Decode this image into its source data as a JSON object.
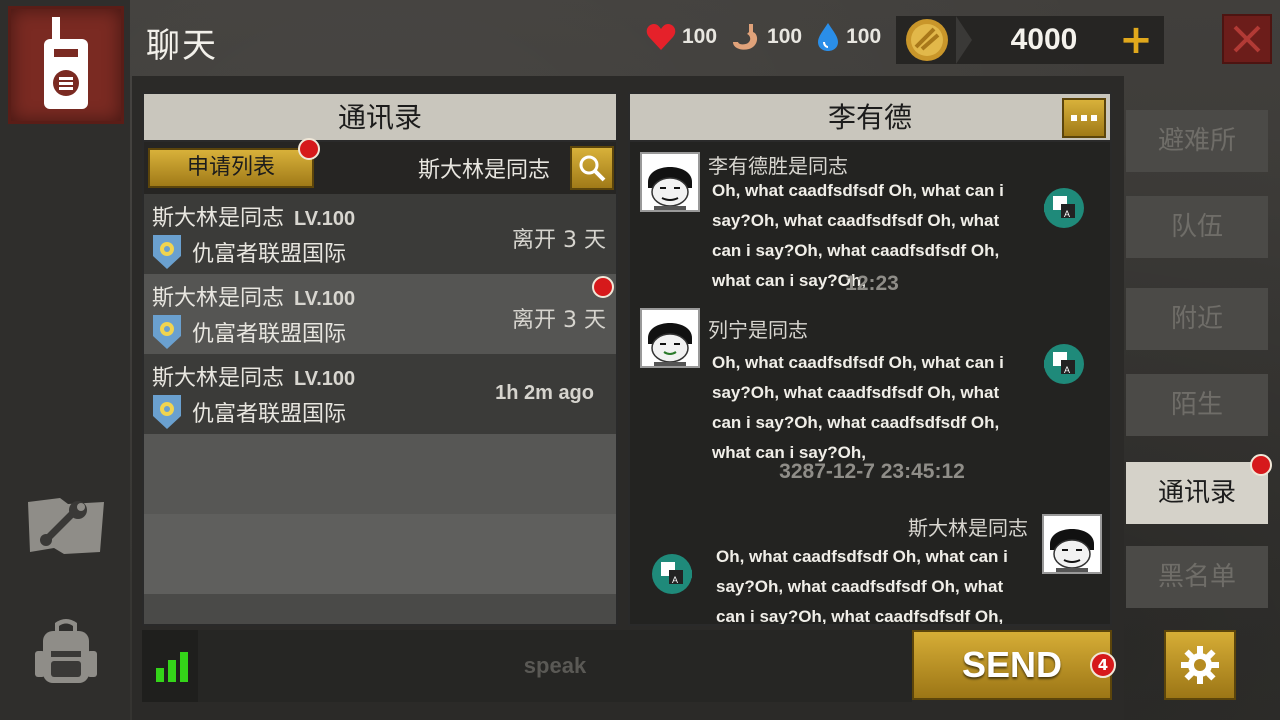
{
  "header": {
    "title": "聊天",
    "stats": [
      {
        "icon": "heart-icon",
        "value": "100"
      },
      {
        "icon": "stomach-icon",
        "value": "100"
      },
      {
        "icon": "water-drop-icon",
        "value": "100"
      }
    ],
    "coins": "4000",
    "coin_plus": "+"
  },
  "contacts_panel": {
    "title": "通讯录",
    "request_button": "申请列表",
    "search_name": "斯大林是同志",
    "rows": [
      {
        "name": "斯大林是同志",
        "level": "LV.100",
        "guild": "仇富者联盟国际",
        "status": "离开 3 天"
      },
      {
        "name": "斯大林是同志",
        "level": "LV.100",
        "guild": "仇富者联盟国际",
        "status": "离开 3 天"
      },
      {
        "name": "斯大林是同志",
        "level": "LV.100",
        "guild": "仇富者联盟国际",
        "status": "1h 2m ago"
      }
    ]
  },
  "chat_panel": {
    "title": "李有德",
    "messages": [
      {
        "sender": "李有德胜是同志",
        "text": "Oh, what caadfsdfsdf Oh, what can i say?Oh, what caadfsdfsdf Oh, what can i say?Oh, what caadfsdfsdf Oh, what can i say?Oh,"
      },
      {
        "sender": "列宁是同志",
        "text": "Oh, what caadfsdfsdf Oh, what can i say?Oh, what caadfsdfsdf Oh, what can i say?Oh, what caadfsdfsdf Oh, what can i say?Oh,"
      },
      {
        "sender": "斯大林是同志",
        "text": "Oh, what caadfsdfsdf Oh, what can i say?Oh, what caadfsdfsdf Oh, what can i say?Oh, what caadfsdfsdf Oh, what can i say?Oh,"
      }
    ],
    "timestamps": [
      "12:23",
      "3287-12-7 23:45:12"
    ]
  },
  "tabs": [
    "避难所",
    "队伍",
    "附近",
    "陌生",
    "通讯录",
    "黑名单"
  ],
  "input": {
    "placeholder": "speak",
    "send_label": "SEND",
    "send_badge": "4"
  },
  "colors": {
    "gold": "#c99a26",
    "notify_red": "#d6191b",
    "signal_green": "#34d419"
  }
}
